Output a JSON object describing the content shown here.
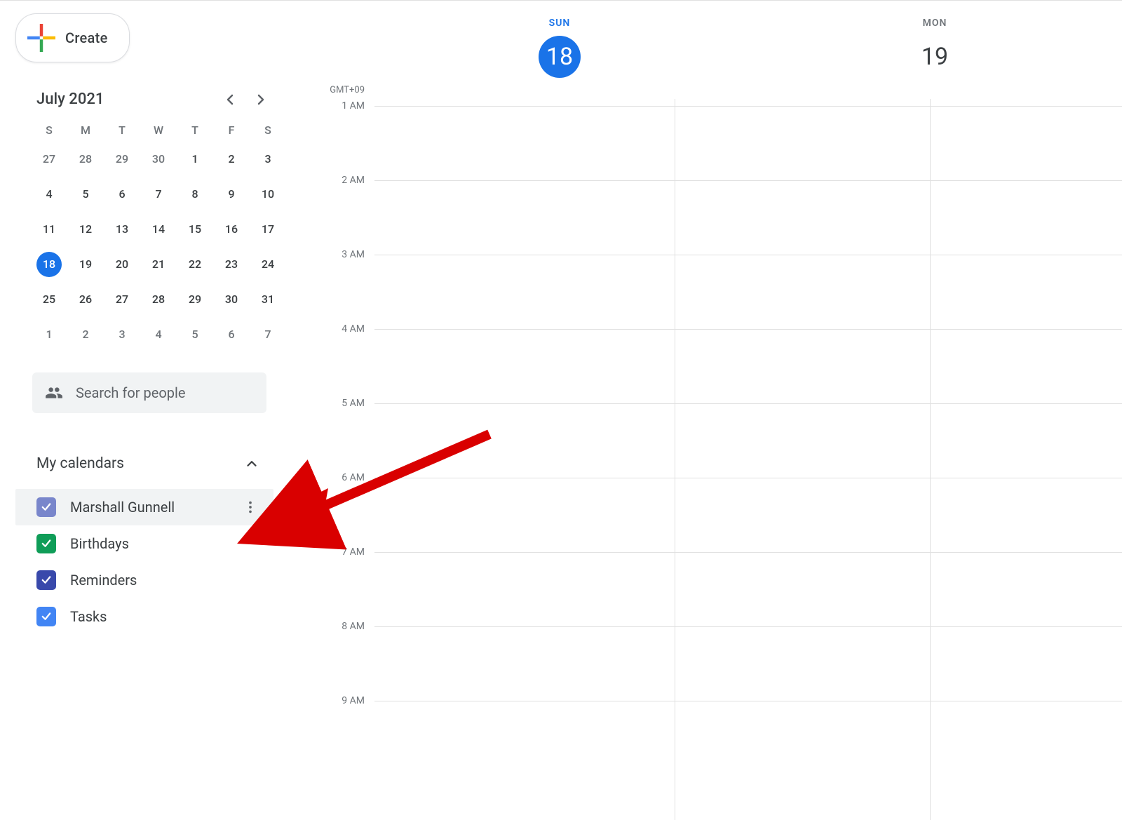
{
  "create_label": "Create",
  "mini_calendar": {
    "month_label": "July 2021",
    "day_headers": [
      "S",
      "M",
      "T",
      "W",
      "T",
      "F",
      "S"
    ],
    "weeks": [
      [
        {
          "n": "27",
          "muted": true
        },
        {
          "n": "28",
          "muted": true
        },
        {
          "n": "29",
          "muted": true
        },
        {
          "n": "30",
          "muted": true
        },
        {
          "n": "1"
        },
        {
          "n": "2"
        },
        {
          "n": "3"
        }
      ],
      [
        {
          "n": "4"
        },
        {
          "n": "5"
        },
        {
          "n": "6"
        },
        {
          "n": "7"
        },
        {
          "n": "8"
        },
        {
          "n": "9"
        },
        {
          "n": "10"
        }
      ],
      [
        {
          "n": "11"
        },
        {
          "n": "12"
        },
        {
          "n": "13"
        },
        {
          "n": "14"
        },
        {
          "n": "15"
        },
        {
          "n": "16"
        },
        {
          "n": "17"
        }
      ],
      [
        {
          "n": "18",
          "today": true
        },
        {
          "n": "19"
        },
        {
          "n": "20"
        },
        {
          "n": "21"
        },
        {
          "n": "22"
        },
        {
          "n": "23"
        },
        {
          "n": "24"
        }
      ],
      [
        {
          "n": "25"
        },
        {
          "n": "26"
        },
        {
          "n": "27"
        },
        {
          "n": "28"
        },
        {
          "n": "29"
        },
        {
          "n": "30"
        },
        {
          "n": "31"
        }
      ],
      [
        {
          "n": "1",
          "muted": true
        },
        {
          "n": "2",
          "muted": true
        },
        {
          "n": "3",
          "muted": true
        },
        {
          "n": "4",
          "muted": true
        },
        {
          "n": "5",
          "muted": true
        },
        {
          "n": "6",
          "muted": true
        },
        {
          "n": "7",
          "muted": true
        }
      ]
    ]
  },
  "search_placeholder": "Search for people",
  "my_calendars_label": "My calendars",
  "calendars": [
    {
      "label": "Marshall Gunnell",
      "color": "#7986cb",
      "highlight": true,
      "show_menu": true
    },
    {
      "label": "Birthdays",
      "color": "#0f9d58",
      "highlight": false,
      "show_menu": false
    },
    {
      "label": "Reminders",
      "color": "#3949ab",
      "highlight": false,
      "show_menu": false
    },
    {
      "label": "Tasks",
      "color": "#4285f4",
      "highlight": false,
      "show_menu": false
    }
  ],
  "timezone_label": "GMT+09",
  "days": [
    {
      "dow": "SUN",
      "num": "18",
      "today": true
    },
    {
      "dow": "MON",
      "num": "19",
      "today": false
    }
  ],
  "hours": [
    "1 AM",
    "2 AM",
    "3 AM",
    "4 AM",
    "5 AM",
    "6 AM",
    "7 AM",
    "8 AM",
    "9 AM"
  ]
}
